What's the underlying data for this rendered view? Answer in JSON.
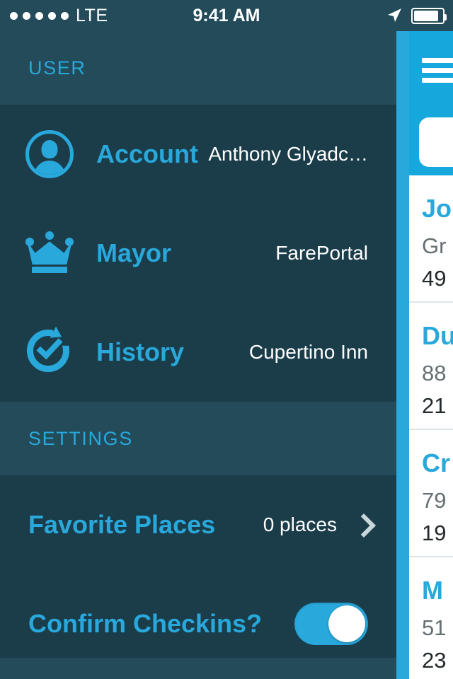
{
  "status_bar": {
    "signal_dots": 5,
    "carrier": "LTE",
    "time": "9:41 AM",
    "location_icon": "location-arrow-icon",
    "battery_icon": "battery-icon"
  },
  "drawer": {
    "sections": [
      {
        "header": "USER",
        "rows": [
          {
            "icon": "account-icon",
            "title": "Account",
            "value": "Anthony Glyadc…",
            "chevron": false
          },
          {
            "icon": "crown-icon",
            "title": "Mayor",
            "value": "FarePortal",
            "chevron": false
          },
          {
            "icon": "history-icon",
            "title": "History",
            "value": "Cupertino Inn",
            "chevron": false
          }
        ]
      },
      {
        "header": "SETTINGS",
        "rows": [
          {
            "icon": "none",
            "title": "Favorite Places",
            "value": "0 places",
            "chevron": true
          },
          {
            "icon": "none",
            "title": "Confirm Checkins?",
            "toggle": true,
            "toggle_state": "on"
          }
        ]
      }
    ]
  },
  "main_panel": {
    "menu_icon": "hamburger-menu-icon",
    "search_placeholder": "",
    "search_value": "",
    "cards": [
      {
        "title": "Jo",
        "subtitle": "Gr",
        "meta": "49"
      },
      {
        "title": "Du",
        "subtitle": "88",
        "meta": "21"
      },
      {
        "title": "Cr",
        "subtitle": "79",
        "meta": "19"
      },
      {
        "title": "M",
        "subtitle": "51",
        "meta": "23"
      }
    ]
  },
  "colors": {
    "accent": "#29a8dc",
    "header_blue": "#16a7dd",
    "drawer_bg": "#1b3d4a",
    "section_bg": "#234b59",
    "value_text": "#ffffff"
  }
}
